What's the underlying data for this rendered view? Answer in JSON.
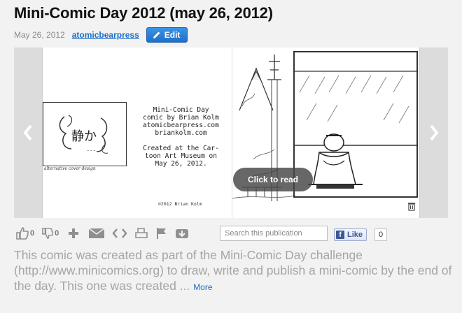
{
  "header": {
    "title": "Mini-Comic Day 2012 (may 26, 2012)",
    "date": "May 26, 2012",
    "author": "atomicbearpress",
    "edit_label": "Edit"
  },
  "viewer": {
    "click_to_read": "Click to read",
    "cover_caption": "alternative cover design",
    "cover_title": "静か",
    "credits": [
      "Mini-Comic Day",
      "comic by Brian Kolm",
      "atomicbearpress.com",
      "briankolm.com",
      "",
      "Created at the Car-",
      "toon Art Museum on",
      "May 26, 2012."
    ],
    "copyright": "©2012 Brian Kolm"
  },
  "toolbar": {
    "like_count": "0",
    "dislike_count": "0",
    "search_placeholder": "Search this publication",
    "fb_like_label": "Like",
    "fb_like_count": "0"
  },
  "description": {
    "text": "This comic was created as part of the Mini-Comic Day challenge (http://www.minicomics.org) to draw, write and publish a mini-comic by the end of the day. This one was created ...",
    "more_label": "More"
  },
  "colors": {
    "accent": "#1b6fc9",
    "edit_button": "#2a82d8",
    "description_text": "#a5a5a5"
  }
}
